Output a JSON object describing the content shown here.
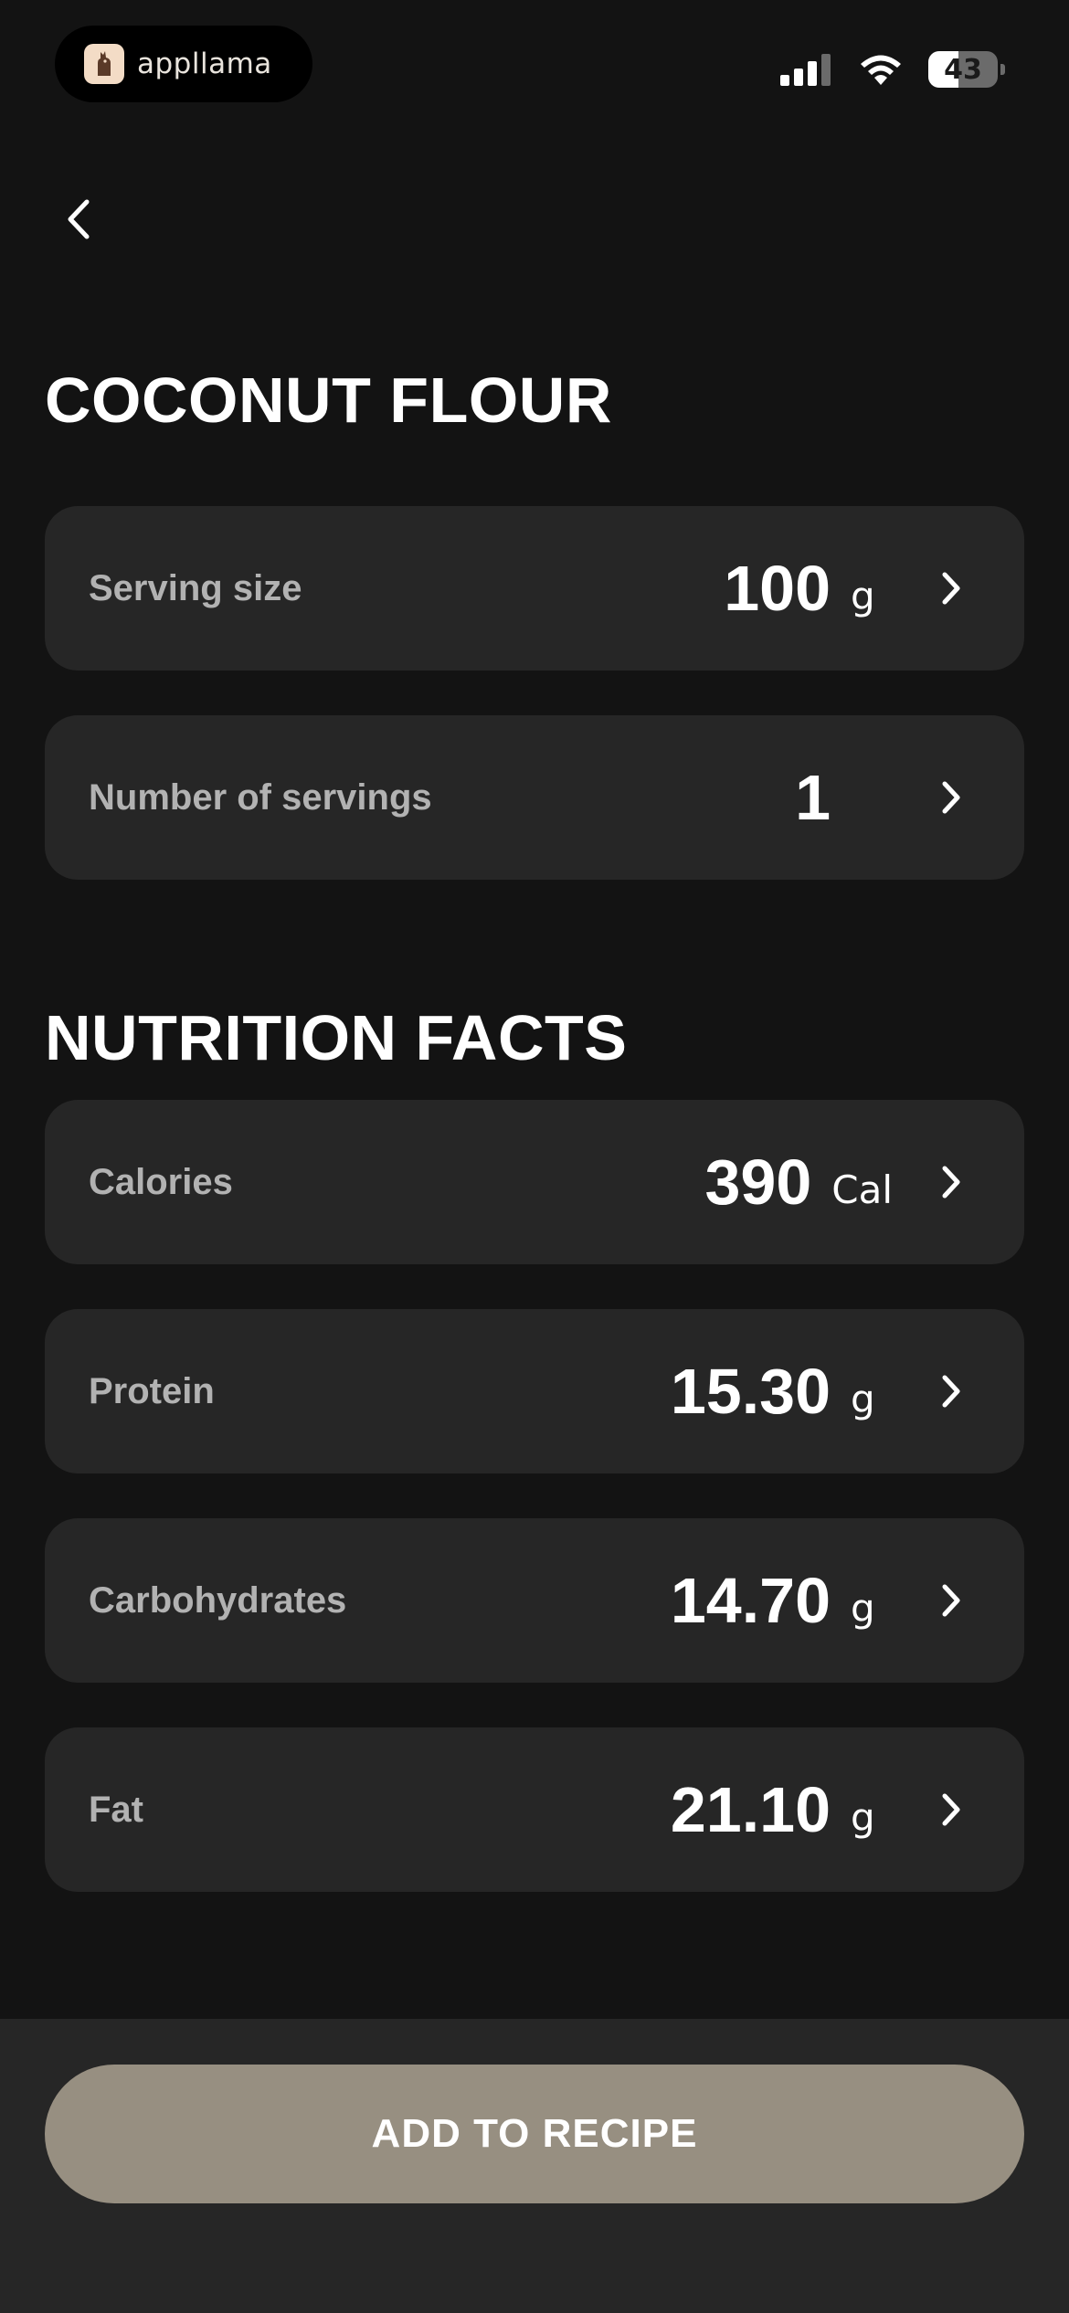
{
  "status_bar": {
    "app_name": "appllama",
    "battery_level": "43"
  },
  "header": {
    "title": "COCONUT FLOUR"
  },
  "serving": {
    "size_label": "Serving size",
    "size_value": "100",
    "size_unit": "g",
    "servings_label": "Number of servings",
    "servings_value": "1"
  },
  "nutrition": {
    "title": "NUTRITION FACTS",
    "items": [
      {
        "label": "Calories",
        "value": "390",
        "unit": "Cal"
      },
      {
        "label": "Protein",
        "value": "15.30",
        "unit": "g"
      },
      {
        "label": "Carbohydrates",
        "value": "14.70",
        "unit": "g"
      },
      {
        "label": "Fat",
        "value": "21.10",
        "unit": "g"
      }
    ]
  },
  "footer": {
    "add_label": "ADD TO RECIPE"
  },
  "colors": {
    "background": "#131313",
    "card": "#262626",
    "label": "#b2b2b2",
    "accent_button": "#978f81"
  }
}
